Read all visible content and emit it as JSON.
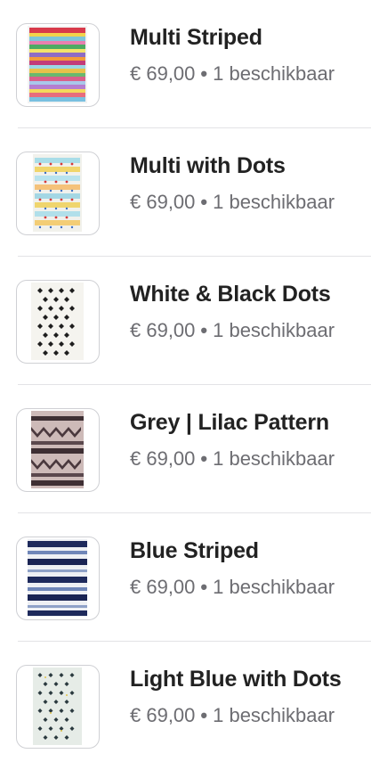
{
  "products": [
    {
      "name": "Multi Striped",
      "price": "€ 69,00",
      "separator": "•",
      "availability": "1 beschikbaar",
      "thumb_icon": "rug-multi-striped"
    },
    {
      "name": "Multi with Dots",
      "price": "€ 69,00",
      "separator": "•",
      "availability": "1 beschikbaar",
      "thumb_icon": "rug-multi-dots"
    },
    {
      "name": "White & Black Dots",
      "price": "€ 69,00",
      "separator": "•",
      "availability": "1 beschikbaar",
      "thumb_icon": "rug-white-black-dots"
    },
    {
      "name": "Grey | Lilac Pattern",
      "price": "€ 69,00",
      "separator": "•",
      "availability": "1 beschikbaar",
      "thumb_icon": "rug-grey-lilac"
    },
    {
      "name": "Blue Striped",
      "price": "€ 69,00",
      "separator": "•",
      "availability": "1 beschikbaar",
      "thumb_icon": "rug-blue-striped"
    },
    {
      "name": "Light Blue with Dots",
      "price": "€ 69,00",
      "separator": "•",
      "availability": "1 beschikbaar",
      "thumb_icon": "rug-light-blue-dots"
    }
  ],
  "colors": {
    "title": "#222222",
    "meta": "#6d6d72",
    "divider": "#e3e3e6",
    "thumb_border": "#cfd0d4"
  }
}
